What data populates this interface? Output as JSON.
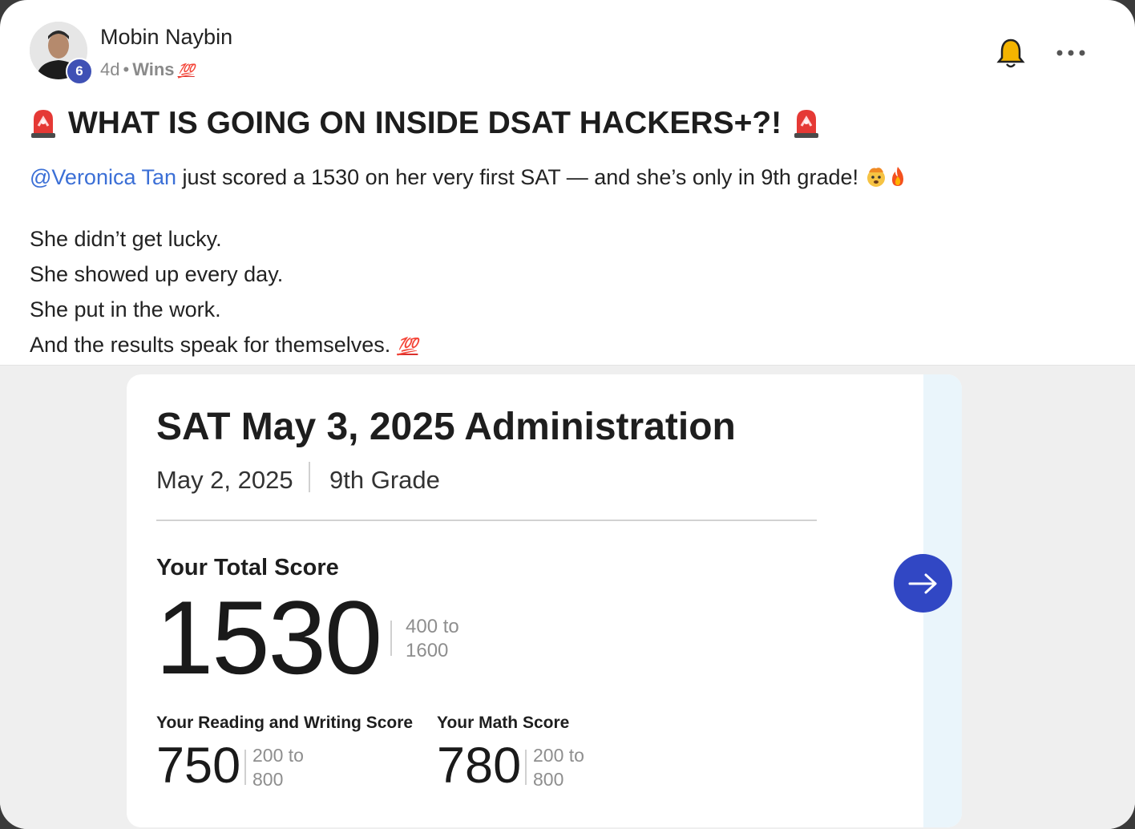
{
  "post": {
    "author": {
      "name": "Mobin Naybin",
      "level": "6"
    },
    "meta": {
      "age": "4d",
      "separator": "•",
      "category": "Wins",
      "category_emoji": "💯"
    },
    "headline": "WHAT IS GOING ON INSIDE DSAT HACKERS+?!",
    "mention": "@Veronica Tan",
    "intro_text": " just scored a 1530 on her very first SAT — and she’s only in 9th grade! ",
    "lines": [
      "She didn’t get lucky.",
      "She showed up every day.",
      "She put in the work.",
      "And the results speak for themselves."
    ],
    "last_line_emoji": "💯"
  },
  "score_report": {
    "title": "SAT May 3, 2025 Administration",
    "date": "May 2, 2025",
    "grade": "9th Grade",
    "total_label": "Your Total Score",
    "total_score": "1530",
    "total_range_line1": "400 to",
    "total_range_line2": "1600",
    "rw_label": "Your Reading and Writing Score",
    "rw_score": "750",
    "math_label": "Your Math Score",
    "math_score": "780",
    "section_range_line1": "200 to",
    "section_range_line2": "800"
  },
  "colors": {
    "mention": "#3b6fd6",
    "level_badge": "#3f51b5",
    "arrow_button": "#3147c4",
    "siren_red": "#e53935"
  },
  "icons": {
    "bell": "bell-icon",
    "more": "more-options-icon",
    "siren": "police-light-emoji",
    "arrow": "arrow-right-icon"
  }
}
